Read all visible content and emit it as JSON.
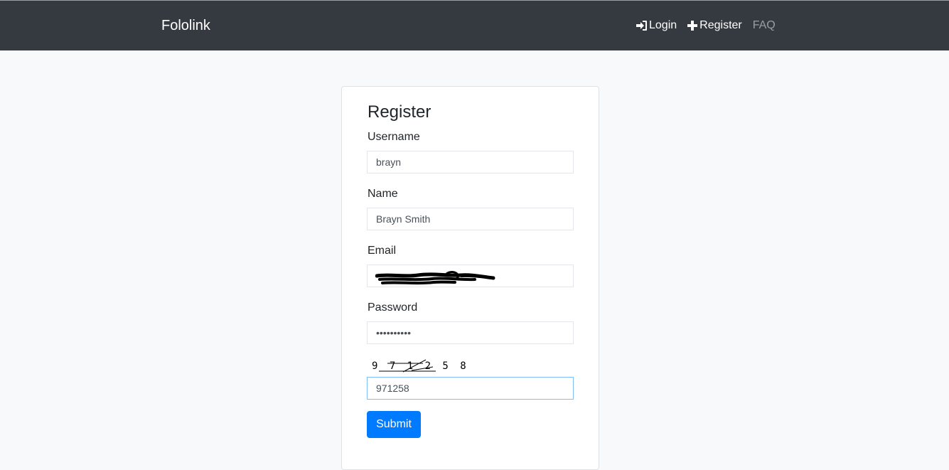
{
  "navbar": {
    "brand": "Fololink",
    "links": [
      {
        "label": "Login",
        "icon": "sign-in-icon"
      },
      {
        "label": "Register",
        "icon": "plus-icon"
      },
      {
        "label": "FAQ"
      }
    ]
  },
  "form": {
    "title": "Register",
    "username": {
      "label": "Username",
      "value": "brayn"
    },
    "name": {
      "label": "Name",
      "value": "Brayn Smith"
    },
    "email": {
      "label": "Email",
      "value": ""
    },
    "password": {
      "label": "Password",
      "value": "••••••••••"
    },
    "captcha": {
      "image_text": "9 7 1 2 5 8",
      "value": "971258"
    },
    "submit_label": "Submit"
  },
  "colors": {
    "navbar_bg": "#343a40",
    "page_bg": "#f8f9fa",
    "primary": "#007bff",
    "focus_border": "#80bdff"
  }
}
